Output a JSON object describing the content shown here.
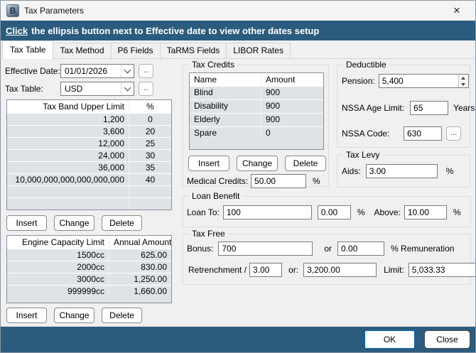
{
  "window": {
    "title": "Tax Parameters",
    "close_glyph": "×"
  },
  "banner": {
    "link_word": "Click",
    "text": "the ellipsis button next to Effective date to view other dates setup"
  },
  "tabs": [
    {
      "label": "Tax Table"
    },
    {
      "label": "Tax Method"
    },
    {
      "label": "P6 Fields"
    },
    {
      "label": "TaRMS Fields"
    },
    {
      "label": "LIBOR Rates"
    }
  ],
  "left": {
    "effective_date": {
      "label": "Effective Date:",
      "value": "01/01/2026",
      "more_button": ".."
    },
    "tax_table": {
      "label": "Tax Table:",
      "value": "USD",
      "more_button": ".."
    },
    "band_table": {
      "headers": [
        "Tax Band Upper Limit",
        "%"
      ],
      "rows": [
        [
          "1,200",
          "0"
        ],
        [
          "3,600",
          "20"
        ],
        [
          "12,000",
          "25"
        ],
        [
          "24,000",
          "30"
        ],
        [
          "36,000",
          "35"
        ],
        [
          "10,000,000,000,000,000,000",
          "40"
        ]
      ]
    },
    "band_buttons": {
      "insert": "Insert",
      "change": "Change",
      "delete": "Delete"
    },
    "engine_table": {
      "headers": [
        "Engine Capacity Limit",
        "Annual Amount"
      ],
      "rows": [
        [
          "1500cc",
          "625.00"
        ],
        [
          "2000cc",
          "830.00"
        ],
        [
          "3000cc",
          "1,250.00"
        ],
        [
          "999999cc",
          "1,660.00"
        ]
      ]
    },
    "engine_buttons": {
      "insert": "Insert",
      "change": "Change",
      "delete": "Delete"
    }
  },
  "tax_credits": {
    "title": "Tax Credits",
    "headers": [
      "Name",
      "Amount"
    ],
    "rows": [
      [
        "Blind",
        "900"
      ],
      [
        "Disability",
        "900"
      ],
      [
        "Elderly",
        "900"
      ],
      [
        "Spare",
        "0"
      ]
    ],
    "buttons": {
      "insert": "Insert",
      "change": "Change",
      "delete": "Delete"
    },
    "medical": {
      "label": "Medical Credits:",
      "value": "50.00",
      "unit": "%"
    }
  },
  "deductible": {
    "title": "Deductible",
    "pension": {
      "label": "Pension:",
      "value": "5,400"
    },
    "nssa_age": {
      "label": "NSSA Age Limit:",
      "value": "65",
      "unit": "Years"
    },
    "nssa_code": {
      "label": "NSSA Code:",
      "value": "630",
      "more_button": "..."
    }
  },
  "tax_levy": {
    "title": "Tax Levy",
    "aids": {
      "label": "Aids:",
      "value": "3.00",
      "unit": "%"
    }
  },
  "loan_benefit": {
    "title": "Loan Benefit",
    "loan_to": {
      "label": "Loan To:",
      "value": "100"
    },
    "rate": {
      "value": "0.00",
      "unit": "%"
    },
    "above": {
      "label": "Above:",
      "value": "10.00",
      "unit": "%"
    }
  },
  "tax_free": {
    "title": "Tax Free",
    "bonus": {
      "label": "Bonus:",
      "value": "700",
      "or": "or",
      "pct_value": "0.00",
      "unit": "% Remuneration"
    },
    "retrenchment": {
      "label": "Retrenchment /",
      "value": "3.00",
      "or": "or:",
      "amount": "3,200.00",
      "limit_label": "Limit:",
      "limit_value": "5,033.33"
    }
  },
  "footer": {
    "ok": "OK",
    "close": "Close"
  }
}
